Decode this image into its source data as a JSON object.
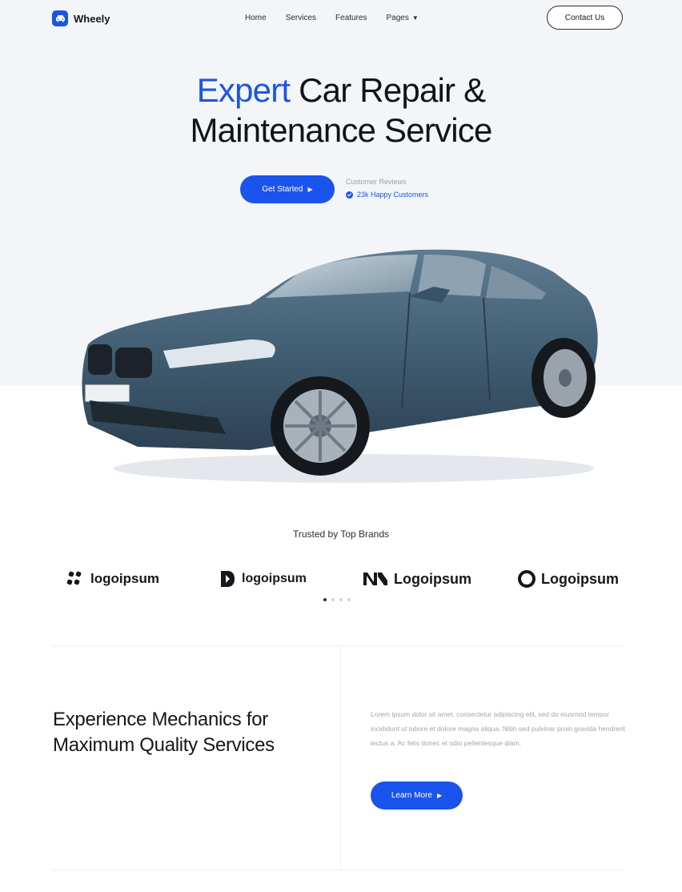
{
  "brand": {
    "name": "Wheely",
    "icon": "car-icon"
  },
  "nav": {
    "links": [
      "Home",
      "Services",
      "Features",
      "Pages"
    ],
    "contact_label": "Contact Us"
  },
  "hero": {
    "headline_accent": "Expert",
    "headline_rest_line1": " Car Repair &",
    "headline_line2": "Maintenance Service",
    "cta_label": "Get Started",
    "reviews_label": "Customer Reviews",
    "reviews_count": "23k Happy Customers"
  },
  "brands": {
    "title": "Trusted by Top Brands",
    "logos": [
      "logoipsum",
      "logoipsum",
      "Logoipsum",
      "Logoipsum"
    ],
    "carousel": {
      "pages": 4,
      "active": 1
    }
  },
  "about": {
    "title": "Experience Mechanics for Maximum Quality Services",
    "body": "Lorem ipsum dolor sit amet, consectetur adipiscing elit, sed do eiusmod tempor incididunt ut labore et dolore magna aliqua. Nibh sed pulvinar proin gravida hendrerit lectus a. Ac felis donec et odio pellentesque diam.",
    "button_label": "Learn More"
  },
  "colors": {
    "accent": "#1c54e4",
    "hero_bg": "#f3f5f8",
    "text": "#15161b",
    "muted": "#a0a5ae"
  }
}
